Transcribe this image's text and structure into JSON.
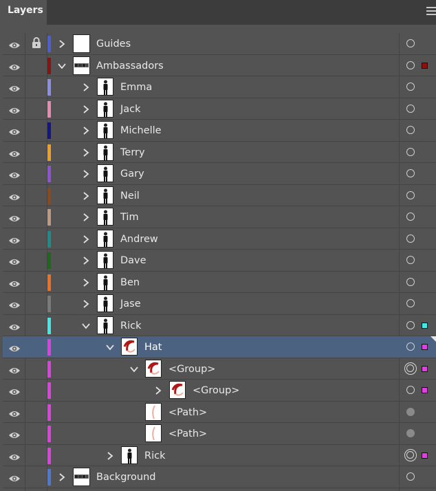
{
  "panel": {
    "tab_label": "Layers",
    "menu_icon": "hamburger-menu-icon"
  },
  "layers": [
    {
      "name": "Guides",
      "depth": 0,
      "expanded": false,
      "color": "#4c5fd6",
      "locked": true,
      "thumb": "blank",
      "target": "circle",
      "square": null,
      "selected": false
    },
    {
      "name": "Ambassadors",
      "depth": 0,
      "expanded": true,
      "color": "#8c1111",
      "locked": false,
      "thumb": "banner",
      "target": "circle",
      "square": "#8c1111",
      "selected": false
    },
    {
      "name": "Emma",
      "depth": 1,
      "expanded": false,
      "color": "#8e8ee8",
      "locked": false,
      "thumb": "person",
      "target": "circle",
      "square": null,
      "selected": false
    },
    {
      "name": "Jack",
      "depth": 1,
      "expanded": false,
      "color": "#e98bb0",
      "locked": false,
      "thumb": "person",
      "target": "circle",
      "square": null,
      "selected": false
    },
    {
      "name": "Michelle",
      "depth": 1,
      "expanded": false,
      "color": "#14148c",
      "locked": false,
      "thumb": "person",
      "target": "circle",
      "square": null,
      "selected": false
    },
    {
      "name": "Terry",
      "depth": 1,
      "expanded": false,
      "color": "#f0a020",
      "locked": false,
      "thumb": "person",
      "target": "circle",
      "square": null,
      "selected": false
    },
    {
      "name": "Gary",
      "depth": 1,
      "expanded": false,
      "color": "#9050d8",
      "locked": false,
      "thumb": "person",
      "target": "circle",
      "square": null,
      "selected": false
    },
    {
      "name": "Neil",
      "depth": 1,
      "expanded": false,
      "color": "#8c4a1c",
      "locked": false,
      "thumb": "person",
      "target": "circle",
      "square": null,
      "selected": false
    },
    {
      "name": "Tim",
      "depth": 1,
      "expanded": false,
      "color": "#c09a80",
      "locked": false,
      "thumb": "person",
      "target": "circle",
      "square": null,
      "selected": false
    },
    {
      "name": "Andrew",
      "depth": 1,
      "expanded": false,
      "color": "#1a8c8c",
      "locked": false,
      "thumb": "person",
      "target": "circle",
      "square": null,
      "selected": false
    },
    {
      "name": "Dave",
      "depth": 1,
      "expanded": false,
      "color": "#1a6a1a",
      "locked": false,
      "thumb": "person",
      "target": "circle",
      "square": null,
      "selected": false
    },
    {
      "name": "Ben",
      "depth": 1,
      "expanded": false,
      "color": "#f07020",
      "locked": false,
      "thumb": "person",
      "target": "circle",
      "square": null,
      "selected": false
    },
    {
      "name": "Jase",
      "depth": 1,
      "expanded": false,
      "color": "#7a7a7a",
      "locked": false,
      "thumb": "person",
      "target": "circle",
      "square": null,
      "selected": false
    },
    {
      "name": "Rick",
      "depth": 1,
      "expanded": true,
      "color": "#40e8e8",
      "locked": false,
      "thumb": "person",
      "target": "circle",
      "square": "#40e8e8",
      "selected": false
    },
    {
      "name": "Hat",
      "depth": 2,
      "expanded": true,
      "color": "#e040e0",
      "locked": false,
      "thumb": "hat",
      "target": "circle",
      "square": "#e040e0",
      "selected": true
    },
    {
      "name": "<Group>",
      "depth": 3,
      "expanded": true,
      "color": "#e040e0",
      "locked": false,
      "thumb": "hat",
      "target": "double",
      "square": "#e040e0",
      "selected": false
    },
    {
      "name": "<Group>",
      "depth": 4,
      "expanded": false,
      "color": "#e040e0",
      "locked": false,
      "thumb": "hat",
      "target": "circle",
      "square": "#e040e0",
      "selected": false
    },
    {
      "name": "<Path>",
      "depth": 3,
      "expanded": null,
      "color": "#e040e0",
      "locked": false,
      "thumb": "path",
      "target": "filled",
      "square": null,
      "selected": false
    },
    {
      "name": "<Path>",
      "depth": 3,
      "expanded": null,
      "color": "#e040e0",
      "locked": false,
      "thumb": "path",
      "target": "filled",
      "square": null,
      "selected": false
    },
    {
      "name": "Rick",
      "depth": 2,
      "expanded": false,
      "color": "#e040e0",
      "locked": false,
      "thumb": "person",
      "target": "double",
      "square": "#e040e0",
      "selected": false
    },
    {
      "name": "Background",
      "depth": 0,
      "expanded": false,
      "color": "#4c78d6",
      "locked": false,
      "thumb": "banner",
      "target": "circle",
      "square": null,
      "selected": false
    }
  ]
}
